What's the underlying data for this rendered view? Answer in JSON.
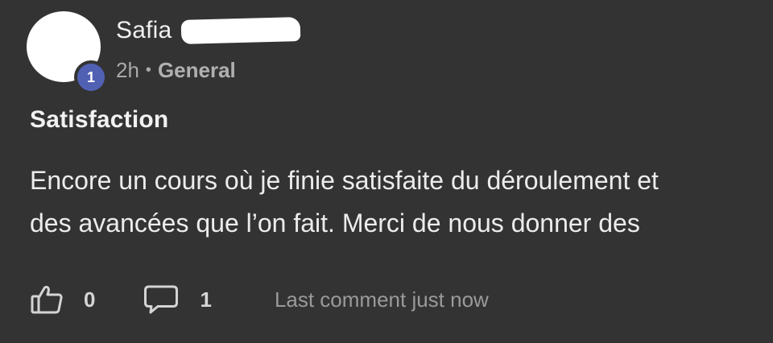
{
  "post": {
    "author": {
      "name": "Safia",
      "level": "1",
      "name_redacted": true
    },
    "meta": {
      "time": "2h",
      "separator": "•",
      "category": "General"
    },
    "title": "Satisfaction",
    "body": "Encore un cours où je finie satisfaite du déroulement et\ndes avancées que l’on fait. Merci de nous donner des",
    "footer": {
      "like_count": "0",
      "comment_count": "1",
      "last_comment": "Last comment just now"
    }
  },
  "colors": {
    "background": "#333333",
    "text": "#eeeeee",
    "muted": "#a9a9a9",
    "badge": "#5060b3"
  },
  "icons": {
    "like": "thumbs-up-icon",
    "comment": "comment-bubble-icon"
  }
}
